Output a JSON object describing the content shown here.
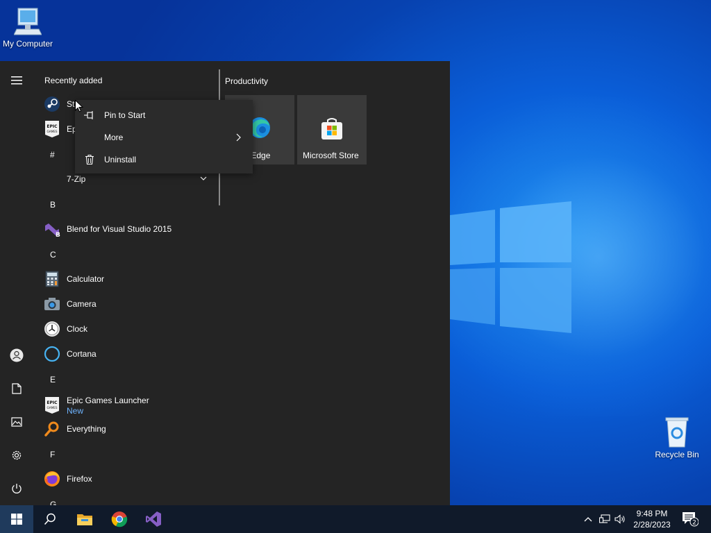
{
  "desktop": {
    "icons": [
      {
        "label": "My Computer",
        "icon": "computer-icon"
      },
      {
        "label": "Recycle Bin",
        "icon": "recycle-bin-icon"
      }
    ]
  },
  "start_menu": {
    "recently_added_header": "Recently added",
    "recent": [
      {
        "label": "St",
        "icon": "steam-icon"
      },
      {
        "label": "Ep",
        "icon": "epic-games-icon"
      }
    ],
    "letters": [
      "#",
      "B",
      "C",
      "E",
      "F",
      "G"
    ],
    "apps": [
      {
        "label": "7-Zip",
        "icon": "folder-icon",
        "expandable": true
      },
      {
        "label": "Blend for Visual Studio 2015",
        "icon": "blend-icon"
      },
      {
        "label": "Calculator",
        "icon": "calculator-icon"
      },
      {
        "label": "Camera",
        "icon": "camera-icon"
      },
      {
        "label": "Clock",
        "icon": "clock-icon"
      },
      {
        "label": "Cortana",
        "icon": "cortana-icon"
      },
      {
        "label": "Epic Games Launcher",
        "sub": "New",
        "icon": "epic-games-icon"
      },
      {
        "label": "Everything",
        "icon": "search-magnifier-icon"
      },
      {
        "label": "Firefox",
        "icon": "firefox-icon"
      }
    ],
    "epic_badge_lines": [
      "EPIC",
      "GAMES"
    ],
    "tiles_header": "Productivity",
    "tiles": [
      {
        "label": "osoft Edge",
        "icon": "edge-icon"
      },
      {
        "label": "Microsoft Store",
        "icon": "store-icon"
      }
    ]
  },
  "context_menu": {
    "items": [
      {
        "label": "Pin to Start",
        "icon": "pin-icon"
      },
      {
        "label": "More",
        "icon": "chevron-right-icon"
      },
      {
        "label": "Uninstall",
        "icon": "trash-icon"
      }
    ]
  },
  "taskbar": {
    "clock_time": "9:48 PM",
    "clock_date": "2/28/2023",
    "notification_count": "2"
  },
  "colors": {
    "start_bg": "#242424",
    "tile_bg": "#3a3a3a",
    "accent_new": "#6fb4ff",
    "taskbar_bg": "#101a2a"
  }
}
